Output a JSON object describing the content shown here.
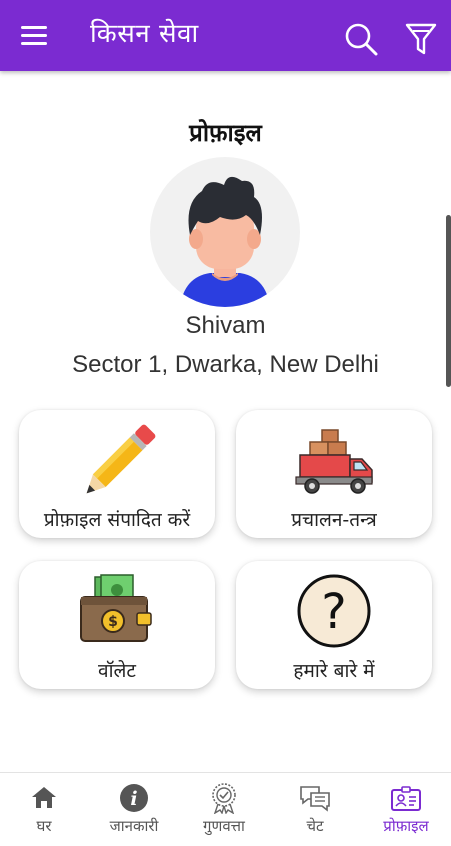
{
  "app": {
    "title": "किसन सेवा"
  },
  "toolbar": {
    "menu_icon": "menu-icon",
    "search_icon": "search-icon",
    "filter_icon": "filter-icon",
    "color": "#7b2bd1"
  },
  "profile": {
    "page_title": "प्रोफ़ाइल",
    "name": "Shivam",
    "address": "Sector 1, Dwarka, New Delhi",
    "avatar_icon": "user-avatar-icon"
  },
  "cards": [
    {
      "label": "प्रोफ़ाइल संपादित करें",
      "icon": "pencil-icon"
    },
    {
      "label": "प्रचालन-तन्त्र",
      "icon": "delivery-truck-icon"
    },
    {
      "label": "वॉलेट",
      "icon": "wallet-icon"
    },
    {
      "label": "हमारे बारे में",
      "icon": "question-mark-icon"
    }
  ],
  "bottom_nav": {
    "items": [
      {
        "label": "घर",
        "icon": "home-icon",
        "active": false
      },
      {
        "label": "जानकारी",
        "icon": "info-icon",
        "active": false
      },
      {
        "label": "गुणवत्ता",
        "icon": "quality-badge-icon",
        "active": false
      },
      {
        "label": "चेट",
        "icon": "chat-icon",
        "active": false
      },
      {
        "label": "प्रोफ़ाइल",
        "icon": "profile-card-icon",
        "active": true
      }
    ],
    "active_color": "#7b2bd1"
  }
}
